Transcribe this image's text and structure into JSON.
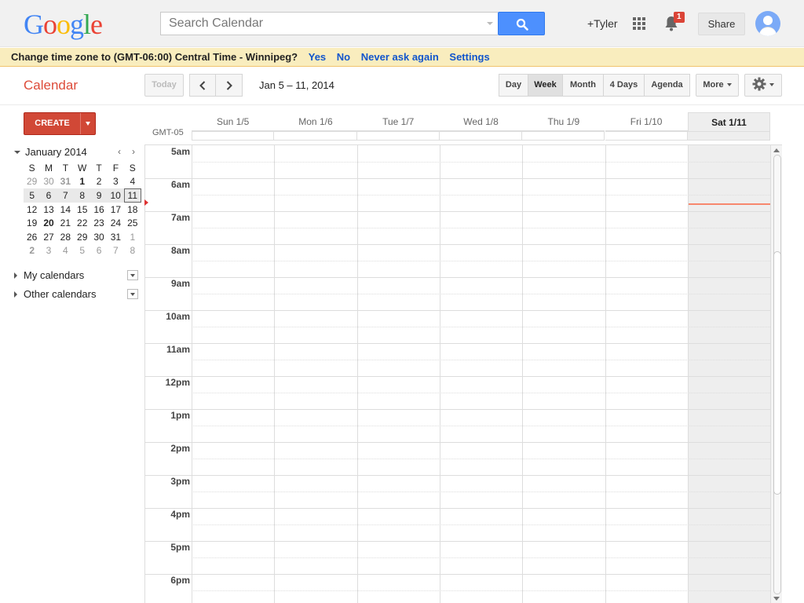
{
  "header": {
    "logo_letters": [
      {
        "ch": "G",
        "color": "#4285f4"
      },
      {
        "ch": "o",
        "color": "#ea4335"
      },
      {
        "ch": "o",
        "color": "#fbbc05"
      },
      {
        "ch": "g",
        "color": "#4285f4"
      },
      {
        "ch": "l",
        "color": "#34a853"
      },
      {
        "ch": "e",
        "color": "#ea4335"
      }
    ],
    "search_placeholder": "Search Calendar",
    "user_link": "+Tyler",
    "notification_count": "1",
    "share_label": "Share"
  },
  "notice": {
    "message": "Change time zone to (GMT-06:00) Central Time - Winnipeg?",
    "yes": "Yes",
    "no": "No",
    "never": "Never ask again",
    "settings": "Settings"
  },
  "toolbar": {
    "app_title": "Calendar",
    "today_label": "Today",
    "date_range": "Jan 5 – 11, 2014",
    "views": [
      "Day",
      "Week",
      "Month",
      "4 Days",
      "Agenda"
    ],
    "selected_view": "Week",
    "more_label": "More"
  },
  "sidebar": {
    "create_label": "CREATE",
    "mini_calendar": {
      "title": "January 2014",
      "weekdays": [
        "S",
        "M",
        "T",
        "W",
        "T",
        "F",
        "S"
      ],
      "weeks": [
        [
          "29",
          "30",
          "31",
          "1",
          "2",
          "3",
          "4"
        ],
        [
          "5",
          "6",
          "7",
          "8",
          "9",
          "10",
          "11"
        ],
        [
          "12",
          "13",
          "14",
          "15",
          "16",
          "17",
          "18"
        ],
        [
          "19",
          "20",
          "21",
          "22",
          "23",
          "24",
          "25"
        ],
        [
          "26",
          "27",
          "28",
          "29",
          "30",
          "31",
          "1"
        ],
        [
          "2",
          "3",
          "4",
          "5",
          "6",
          "7",
          "8"
        ]
      ]
    },
    "my_calendars": "My calendars",
    "other_calendars": "Other calendars"
  },
  "grid": {
    "timezone": "GMT-05",
    "days": [
      "Sun 1/5",
      "Mon 1/6",
      "Tue 1/7",
      "Wed 1/8",
      "Thu 1/9",
      "Fri 1/10",
      "Sat 1/11"
    ],
    "today_index": 6,
    "hours": [
      "5am",
      "6am",
      "7am",
      "8am",
      "9am",
      "10am",
      "11am",
      "12pm",
      "1pm",
      "2pm",
      "3pm",
      "4pm",
      "5pm",
      "6pm"
    ]
  }
}
